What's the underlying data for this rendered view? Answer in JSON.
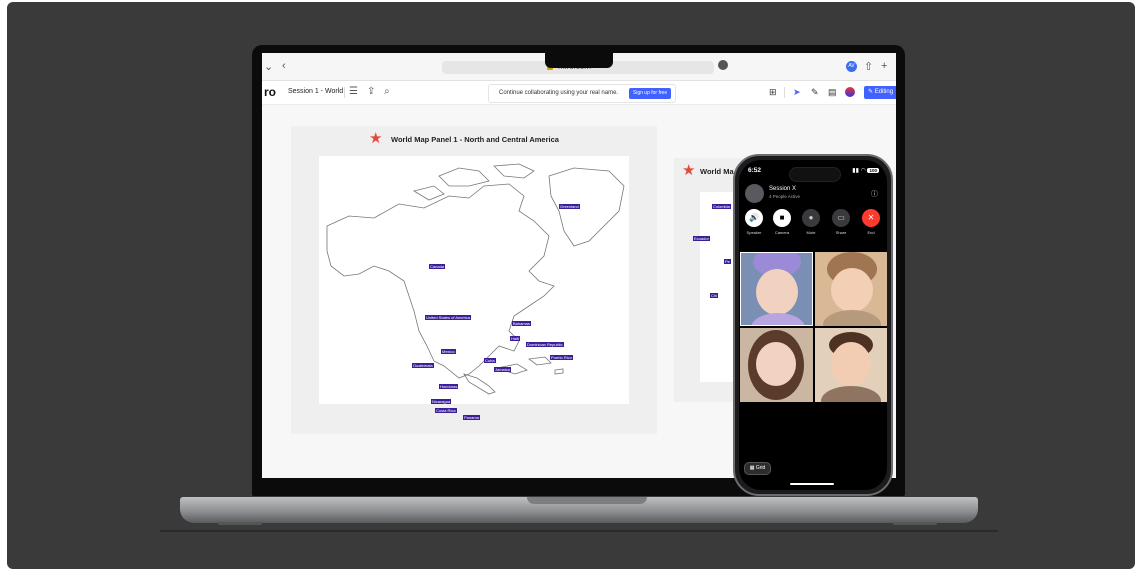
{
  "browser": {
    "url": "miro.com"
  },
  "toolbar": {
    "logo": "ro",
    "board_name": "Session 1 - World",
    "collab_message": "Continue collaborating using your real name.",
    "signup_label": "Sign up for free",
    "editing_label": "Editing",
    "avatar_initials": "AV"
  },
  "panel1": {
    "title": "World Map Panel 1 - North and Central America",
    "labels": {
      "greenland": "Greenland",
      "canada": "Canada",
      "usa": "United States of America",
      "bahamas": "Bahamas",
      "haiti": "Haiti",
      "dominican": "Dominican Republic",
      "puertorico": "Puerto Rico",
      "mexico": "Mexico",
      "cuba": "Cuba",
      "guatemala": "Guatemala",
      "jamaica": "Jamaica",
      "honduras": "Honduras",
      "nicaragua": "Nicaragua",
      "costarica": "Costa Rica",
      "panama": "Panama"
    }
  },
  "panel2": {
    "title": "World Ma",
    "labels": {
      "colombia": "Colombia",
      "ecuador": "Ecuador",
      "pe": "Pe",
      "chi": "Chi"
    }
  },
  "phone": {
    "time": "6:52",
    "battery": "100",
    "session_name": "Session X",
    "session_status": "4 People Active",
    "controls": {
      "speaker": "Speaker",
      "camera": "Camera",
      "mute": "Mute",
      "share": "Share",
      "end": "End"
    },
    "grid_label": "Grid"
  }
}
